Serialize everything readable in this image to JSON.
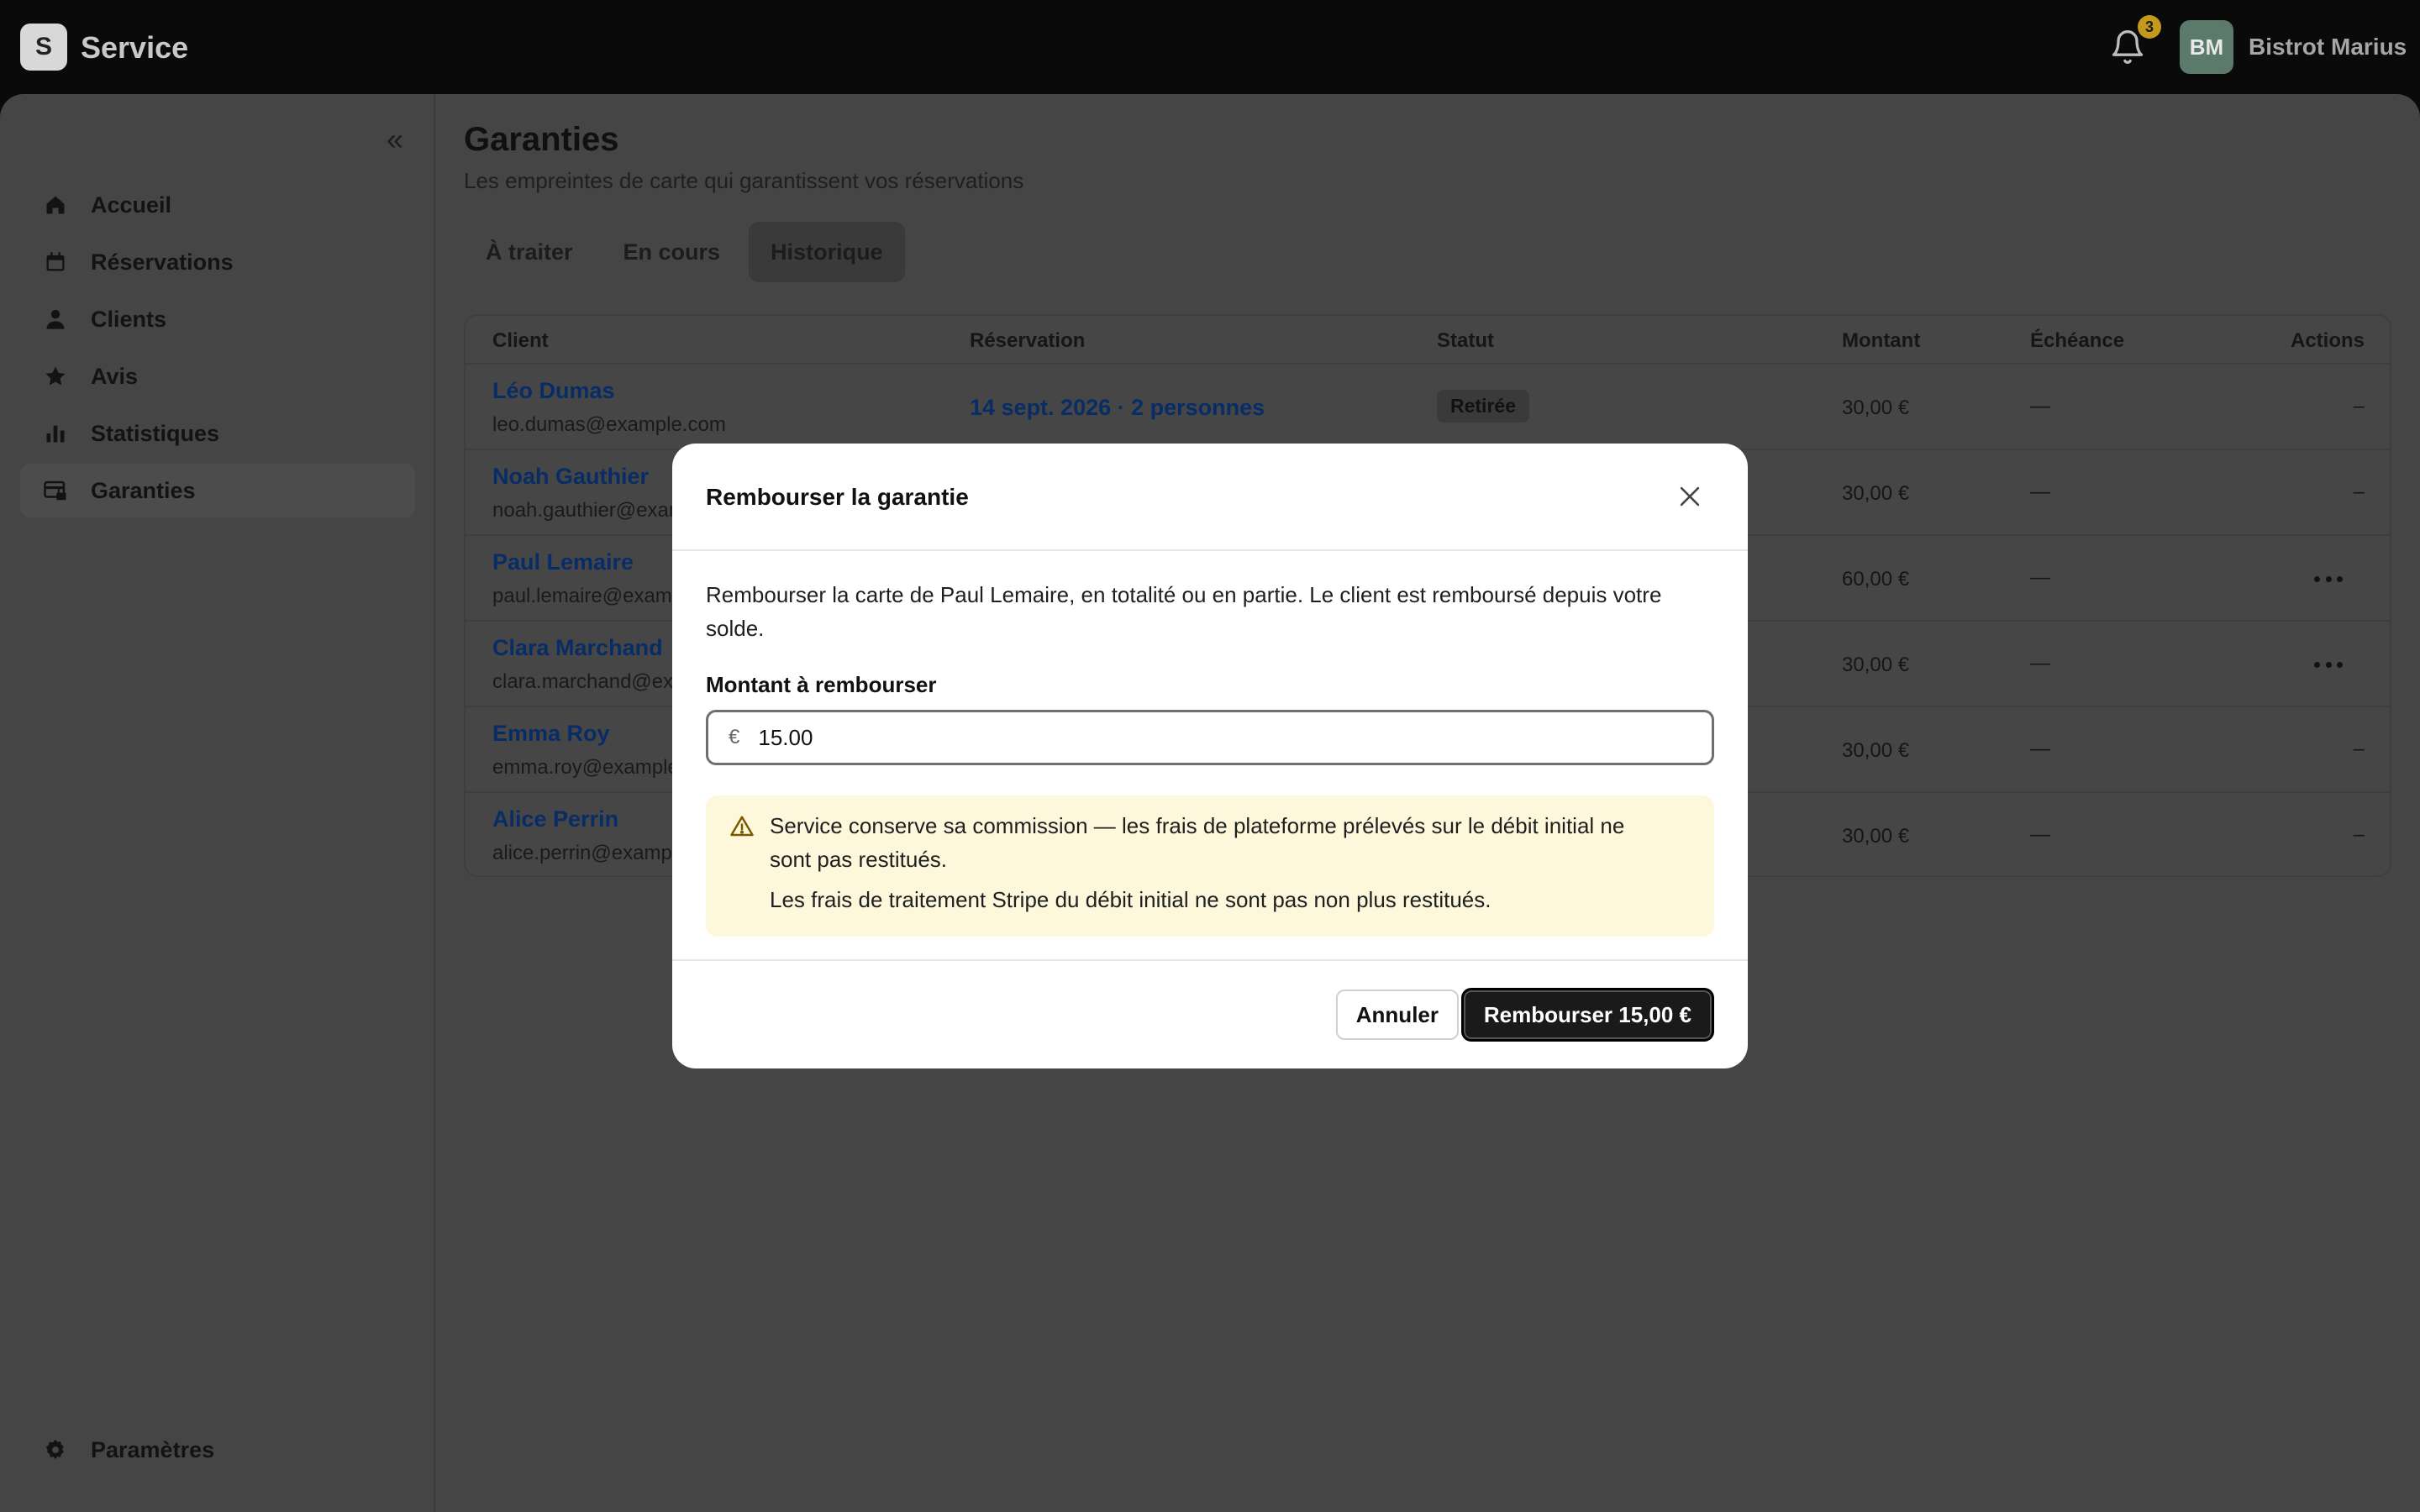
{
  "app": {
    "logo_letter": "S",
    "name": "Service"
  },
  "header": {
    "notification_count": "3",
    "avatar_initials": "BM",
    "org_name": "Bistrot Marius"
  },
  "sidebar": {
    "items": [
      {
        "label": "Accueil",
        "icon": "home-icon"
      },
      {
        "label": "Réservations",
        "icon": "calendar-icon"
      },
      {
        "label": "Clients",
        "icon": "user-icon"
      },
      {
        "label": "Avis",
        "icon": "star-icon"
      },
      {
        "label": "Statistiques",
        "icon": "bar-chart-icon"
      },
      {
        "label": "Garanties",
        "icon": "card-lock-icon",
        "active": true
      }
    ],
    "settings_label": "Paramètres"
  },
  "page": {
    "title": "Garanties",
    "subtitle": "Les empreintes de carte qui garantissent vos réservations",
    "tabs": [
      {
        "label": "À traiter"
      },
      {
        "label": "En cours"
      },
      {
        "label": "Historique",
        "active": true
      }
    ]
  },
  "table": {
    "headers": {
      "client": "Client",
      "reservation": "Réservation",
      "status": "Statut",
      "amount": "Montant",
      "due": "Échéance",
      "actions": "Actions"
    },
    "rows": [
      {
        "name": "Léo Dumas",
        "email": "leo.dumas@example.com",
        "reservation": "14 sept. 2026 · 2 personnes",
        "status": "Retirée",
        "amount": "30,00 €",
        "due": "—",
        "action": "–"
      },
      {
        "name": "Noah Gauthier",
        "email": "noah.gauthier@exam",
        "amount": "30,00 €",
        "due": "—",
        "action": "–"
      },
      {
        "name": "Paul Lemaire",
        "email": "paul.lemaire@exam",
        "amount": "60,00 €",
        "due": "—",
        "action_menu": true
      },
      {
        "name": "Clara Marchand",
        "email": "clara.marchand@ex",
        "amount": "30,00 €",
        "due": "—",
        "action_menu": true
      },
      {
        "name": "Emma Roy",
        "email": "emma.roy@example",
        "amount": "30,00 €",
        "due": "—",
        "action": "–"
      },
      {
        "name": "Alice Perrin",
        "email": "alice.perrin@examp",
        "amount": "30,00 €",
        "due": "—",
        "action": "–"
      }
    ]
  },
  "modal": {
    "title": "Rembourser la garantie",
    "description": "Rembourser la carte de Paul Lemaire, en totalité ou en partie. Le client est remboursé depuis votre solde.",
    "amount_label": "Montant à rembourser",
    "currency_symbol": "€",
    "amount_value": "15.00",
    "warning_line1": "Service conserve sa commission — les frais de plateforme prélevés sur le débit initial ne sont pas restitués.",
    "warning_line2": "Les frais de traitement Stripe du débit initial ne sont pas non plus restitués.",
    "cancel_label": "Annuler",
    "confirm_label": "Rembourser 15,00 €"
  }
}
